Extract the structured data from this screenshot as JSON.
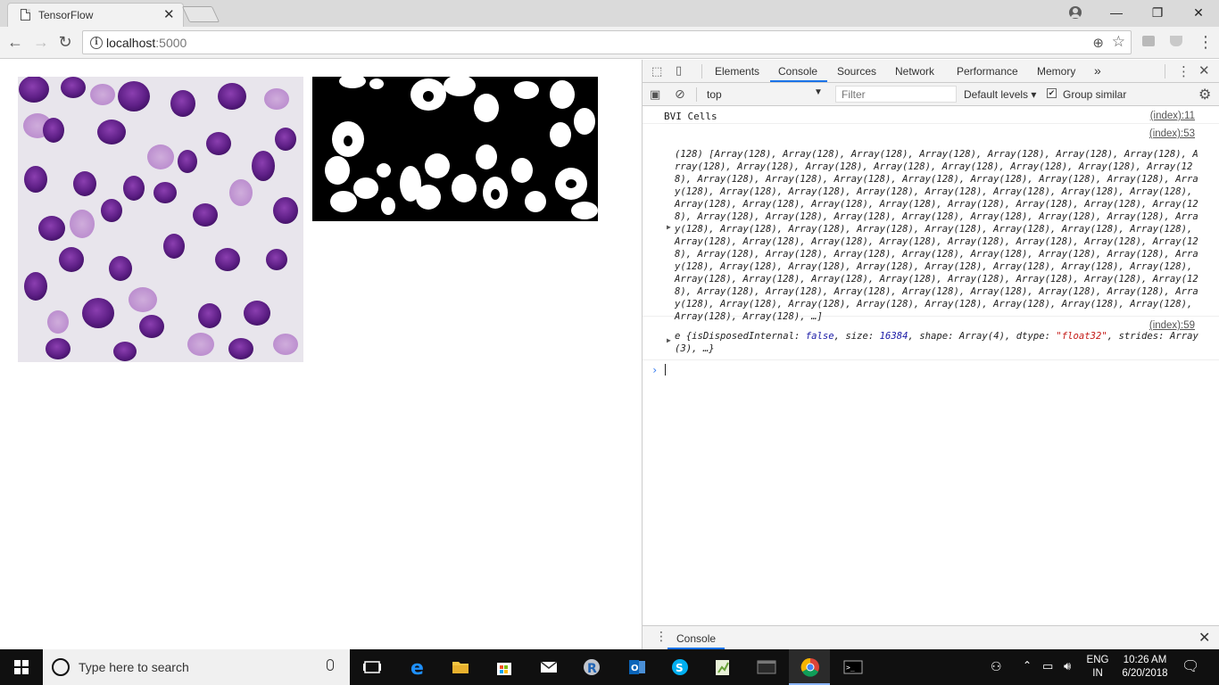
{
  "browser": {
    "tab_title": "TensorFlow",
    "tab_close": "✕",
    "url_host": "localhost",
    "url_port": ":5000",
    "window_controls": {
      "minimize": "—",
      "maximize": "❐",
      "close": "✕"
    }
  },
  "devtools": {
    "tabs": [
      "Elements",
      "Console",
      "Sources",
      "Network",
      "Performance",
      "Memory"
    ],
    "more_tabs": "»",
    "context": "top",
    "filter_placeholder": "Filter",
    "levels": "Default levels ▾",
    "group_similar": "Group similar",
    "group_similar_checked": true,
    "messages": [
      {
        "text": "BVI Cells",
        "source": "(index):11"
      },
      {
        "count": "(128)",
        "source": "(index):53",
        "item": "Array(128)",
        "item_count": 128,
        "truncation": "…"
      },
      {
        "source": "(index):59",
        "object": {
          "name": "e",
          "props": [
            {
              "key": "isDisposedInternal",
              "value": "false",
              "kind": "kw"
            },
            {
              "key": "size",
              "value": "16384",
              "kind": "num"
            },
            {
              "key": "shape",
              "value": "Array(4)",
              "kind": "plain"
            },
            {
              "key": "dtype",
              "value": "\"float32\"",
              "kind": "str"
            },
            {
              "key": "strides",
              "value": "Array(3)",
              "kind": "plain"
            }
          ],
          "truncation": "…"
        }
      }
    ],
    "prompt": "›",
    "drawer_tab": "Console"
  },
  "taskbar": {
    "search_placeholder": "Type here to search",
    "language_top": "ENG",
    "language_bottom": "IN",
    "time": "10:26 AM",
    "date": "6/20/2018"
  },
  "colors": {
    "accent": "#1a73e8",
    "cell_stain": "#6a2a8f",
    "cell_background": "#e9e6ee"
  }
}
